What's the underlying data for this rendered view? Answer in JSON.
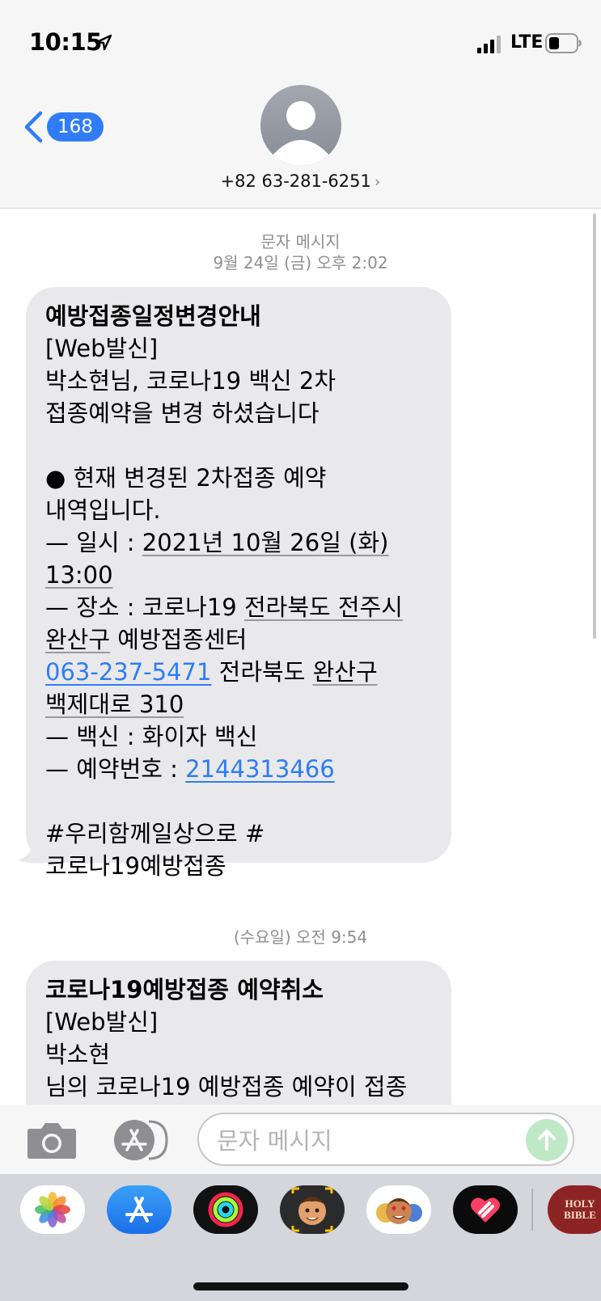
{
  "status_bar": {
    "time": "10:15",
    "network": "LTE"
  },
  "header": {
    "back_count": "168",
    "contact": "+82 63-281-6251",
    "contact_chevron": "›"
  },
  "conversation": {
    "service_label": "문자 메시지",
    "first_timestamp": "9월 24일 (금) 오후 2:02",
    "message1": {
      "title": "예방접종일정변경안내",
      "line1": "[Web발신]",
      "line2": "박소현님, 코로나19 백신 2차 접종예약을 변경 하셨습니다",
      "line3": "● 현재 변경된 2차접종 예약 내역입니다.",
      "date_prefix": "— 일시 : ",
      "date_value": "2021년 10월 26일 (화) 13:00",
      "place_prefix": "— 장소 : 코로나19 ",
      "place_underlined_1": "전라북도 전주시 완산구",
      "place_suffix": " 예방접종센터",
      "phone_link": "063-237-5471",
      "address_prefix": " 전라북도 ",
      "address_underlined": "완산구 백제대로 310",
      "vaccine_line": "— 백신 : 화이자 백신",
      "reservation_prefix": "— 예약번호 : ",
      "reservation_link": "2144313466",
      "hashtags": "#우리함께일상으로 #코로나19예방접종"
    },
    "second_timestamp_day": "(수요일)",
    "second_timestamp_time": " 오전 9:54",
    "message2": {
      "title": "코로나19예방접종 예약취소",
      "line1": "[Web발신]",
      "line2": "박소현",
      "line3": "님의 코로나19 예방접종 예약이 접종"
    }
  },
  "compose": {
    "placeholder": "문자 메시지"
  },
  "drawer": {
    "bible_label_1": "HOLY",
    "bible_label_2": "BIBLE"
  },
  "colors": {
    "accent": "#2f7cf6",
    "bubble": "#e9e9eb",
    "send_disabled": "#bfe8c7"
  }
}
